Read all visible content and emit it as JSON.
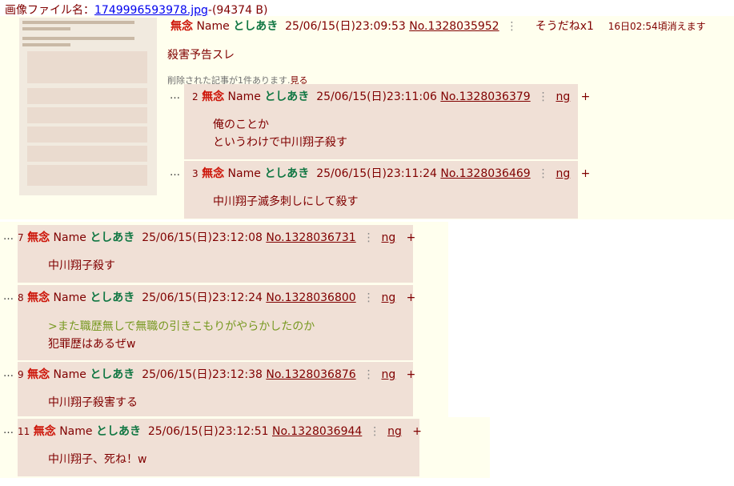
{
  "file": {
    "label": "画像ファイル名：",
    "name": "1749996593978.jpg",
    "size": "-(94374 B)"
  },
  "op": {
    "subject": "無念",
    "name_label": "Name",
    "name": "としあき",
    "date": "25/06/15(日)23:09:53",
    "no": "No.1328035952",
    "menu": "⋮",
    "sodane": "そうだねx1",
    "expire": "16日02:54頃消えます",
    "body": "殺害予告スレ",
    "deleted_note": "削除された記事が1件あります.",
    "deleted_link": "見る"
  },
  "replies": [
    {
      "num": "2",
      "subject": "無念",
      "name_label": "Name",
      "name": "としあき",
      "date": "25/06/15(日)23:11:06",
      "no": "No.1328036379",
      "ng": "ng",
      "plus": "+",
      "lines": [
        {
          "text": "俺のことか",
          "quote": false
        },
        {
          "text": "というわけで中川翔子殺す",
          "quote": false
        }
      ]
    },
    {
      "num": "3",
      "subject": "無念",
      "name_label": "Name",
      "name": "としあき",
      "date": "25/06/15(日)23:11:24",
      "no": "No.1328036469",
      "ng": "ng",
      "plus": "+",
      "lines": [
        {
          "text": "中川翔子滅多刺しにして殺す",
          "quote": false
        }
      ]
    },
    {
      "num": "7",
      "subject": "無念",
      "name_label": "Name",
      "name": "としあき",
      "date": "25/06/15(日)23:12:08",
      "no": "No.1328036731",
      "ng": "ng",
      "plus": "+",
      "lines": [
        {
          "text": "中川翔子殺す",
          "quote": false
        }
      ]
    },
    {
      "num": "8",
      "subject": "無念",
      "name_label": "Name",
      "name": "としあき",
      "date": "25/06/15(日)23:12:24",
      "no": "No.1328036800",
      "ng": "ng",
      "plus": "+",
      "lines": [
        {
          "text": ">また職歴無しで無職の引きこもりがやらかしたのか",
          "quote": true
        },
        {
          "text": "犯罪歴はあるぜw",
          "quote": false
        }
      ]
    },
    {
      "num": "9",
      "subject": "無念",
      "name_label": "Name",
      "name": "としあき",
      "date": "25/06/15(日)23:12:38",
      "no": "No.1328036876",
      "ng": "ng",
      "plus": "+",
      "lines": [
        {
          "text": "中川翔子殺害する",
          "quote": false
        }
      ]
    },
    {
      "num": "11",
      "subject": "無念",
      "name_label": "Name",
      "name": "としあき",
      "date": "25/06/15(日)23:12:51",
      "no": "No.1328036944",
      "ng": "ng",
      "plus": "+",
      "lines": [
        {
          "text": "中川翔子、死ね！w",
          "quote": false
        }
      ]
    }
  ],
  "ellipsis": "…"
}
